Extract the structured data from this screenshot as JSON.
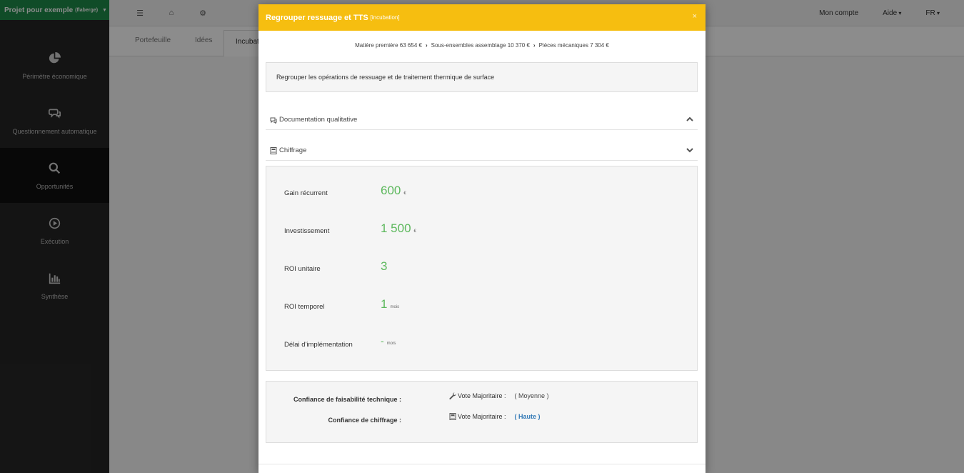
{
  "app": {
    "project_name": "Projet pour exemple",
    "project_owner": "(flaberge)",
    "sidebar": [
      {
        "label": "Périmètre économique",
        "icon": "pie-chart-icon"
      },
      {
        "label": "Questionnement automatique",
        "icon": "comments-icon"
      },
      {
        "label": "Opportunités",
        "icon": "search-icon"
      },
      {
        "label": "Exécution",
        "icon": "play-circle-icon"
      },
      {
        "label": "Synthèse",
        "icon": "bar-chart-icon"
      }
    ],
    "topbar": {
      "account": "Mon compte",
      "help": "Aide",
      "language": "FR"
    },
    "tabs": [
      "Portefeuille",
      "Idées",
      "Incubat"
    ]
  },
  "modal": {
    "title": "Regrouper ressuage et TTS",
    "status": "[incubation]",
    "close_symbol": "×",
    "breadcrumb": [
      "Matière première 63 654 €",
      "Sous-ensembles assemblage 10 370 €",
      "Pièces mécaniques 7 304 €"
    ],
    "description": "Regrouper les opérations de ressuage et de traitement thermique de surface",
    "sections": {
      "documentation": "Documentation qualitative",
      "chiffrage": "Chiffrage"
    },
    "metrics": [
      {
        "label": "Gain récurrent",
        "value": "600",
        "unit": "€"
      },
      {
        "label": "Investissement",
        "value": "1 500",
        "unit": "€"
      },
      {
        "label": "ROI unitaire",
        "value": "3",
        "unit": ""
      },
      {
        "label": "ROI temporel",
        "value": "1",
        "unit": "mois"
      },
      {
        "label": "Délai d'implémentation",
        "value": "-",
        "unit": "mois"
      }
    ],
    "confidence": {
      "technical_label": "Confiance de faisabilité technique :",
      "technical_vote": "Vote Majoritaire :",
      "technical_level": "( Moyenne )",
      "cost_label": "Confiance de chiffrage :",
      "cost_vote": "Vote Majoritaire :",
      "cost_level": "( Haute )"
    }
  }
}
